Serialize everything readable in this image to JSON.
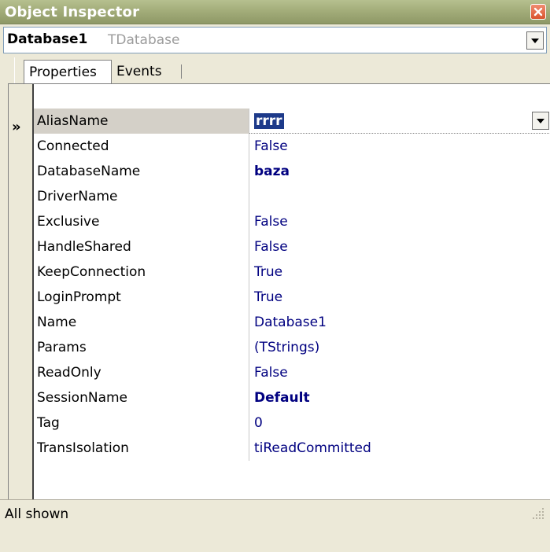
{
  "window": {
    "title": "Object Inspector"
  },
  "selector": {
    "name": "Database1",
    "type": "TDatabase"
  },
  "tabs": [
    {
      "label": "Properties",
      "active": true
    },
    {
      "label": "Events",
      "active": false
    }
  ],
  "properties": [
    {
      "name": "AliasName",
      "value": "rrrr",
      "selected": true,
      "bold": true,
      "has_dropdown": true
    },
    {
      "name": "Connected",
      "value": "False"
    },
    {
      "name": "DatabaseName",
      "value": "baza",
      "bold": true
    },
    {
      "name": "DriverName",
      "value": ""
    },
    {
      "name": "Exclusive",
      "value": "False"
    },
    {
      "name": "HandleShared",
      "value": "False"
    },
    {
      "name": "KeepConnection",
      "value": "True"
    },
    {
      "name": "LoginPrompt",
      "value": "True"
    },
    {
      "name": "Name",
      "value": "Database1"
    },
    {
      "name": "Params",
      "value": "(TStrings)"
    },
    {
      "name": "ReadOnly",
      "value": "False"
    },
    {
      "name": "SessionName",
      "value": "Default",
      "bold": true
    },
    {
      "name": "Tag",
      "value": "0"
    },
    {
      "name": "TransIsolation",
      "value": "tiReadCommitted"
    }
  ],
  "status": {
    "text": "All shown"
  },
  "pointer_glyph": "»",
  "colors": {
    "titlebar": "#a3ad7a",
    "value_text": "#000080",
    "selected_row": "#d4d0c8",
    "close_button": "#d9532e"
  },
  "icons": [
    "close-icon",
    "chevron-down-icon",
    "row-pointer-icon",
    "resize-grip-icon"
  ]
}
